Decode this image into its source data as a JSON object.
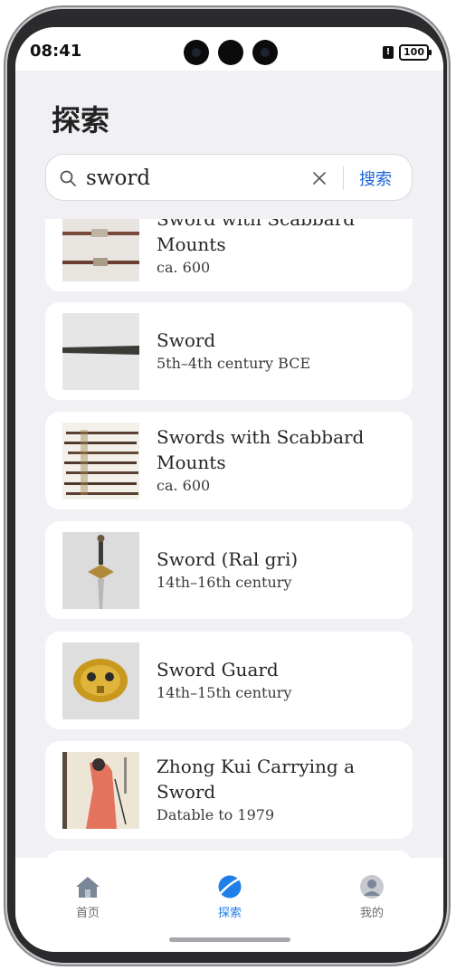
{
  "status_bar": {
    "time": "08:41",
    "alert_glyph": "!",
    "battery": "100"
  },
  "page": {
    "title": "探索"
  },
  "search": {
    "query": "sword",
    "submit_label": "搜索"
  },
  "results": [
    {
      "title": "Sword with Scabbard Mounts",
      "date": "ca. 600",
      "thumb": "scabbard-mounts-thumbnail"
    },
    {
      "title": "Sword",
      "date": "5th–4th century BCE",
      "thumb": "bronze-sword-thumbnail"
    },
    {
      "title": "Swords with Scabbard Mounts",
      "date": "ca. 600",
      "thumb": "multiple-swords-thumbnail"
    },
    {
      "title": "Sword (Ral gri)",
      "date": "14th–16th century",
      "thumb": "ral-gri-thumbnail"
    },
    {
      "title": "Sword Guard",
      "date": "14th–15th century",
      "thumb": "sword-guard-thumbnail"
    },
    {
      "title": "Zhong Kui Carrying a Sword",
      "date": "Datable to 1979",
      "thumb": "painting-thumbnail"
    }
  ],
  "tabbar": {
    "tabs": [
      {
        "label": "首页",
        "icon": "home-icon"
      },
      {
        "label": "探索",
        "icon": "explore-icon",
        "active": true
      },
      {
        "label": "我的",
        "icon": "profile-icon"
      }
    ]
  },
  "colors": {
    "accent": "#1a63d8",
    "tab_active": "#1f7ee8",
    "background": "#f1f1f5"
  }
}
